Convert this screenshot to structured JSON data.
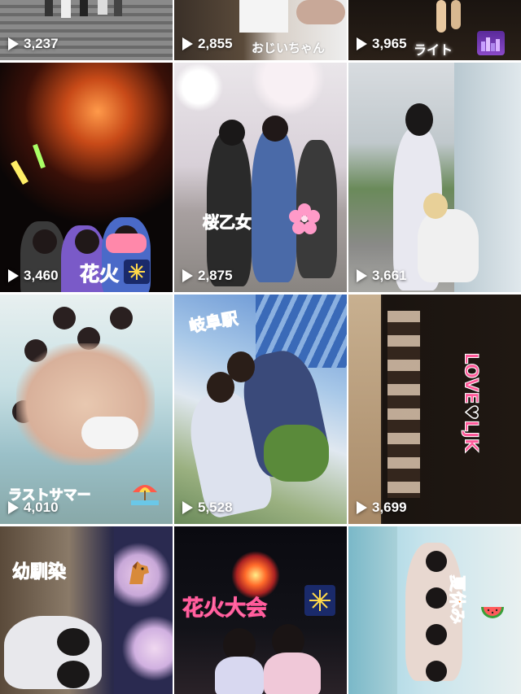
{
  "tiles": [
    {
      "views": "3,237",
      "caption": "",
      "emoji": ""
    },
    {
      "views": "2,855",
      "caption": "おじいちゃん",
      "emoji": ""
    },
    {
      "views": "3,965",
      "caption": "ライト",
      "emoji": "city-night"
    },
    {
      "views": "3,460",
      "caption": "花火",
      "emoji": "fireworks"
    },
    {
      "views": "2,875",
      "caption": "桜乙女",
      "emoji": "cherry-blossom"
    },
    {
      "views": "3,661",
      "caption": "",
      "emoji": ""
    },
    {
      "views": "4,010",
      "caption": "ラストサマー",
      "emoji": "beach-umbrella"
    },
    {
      "views": "5,528",
      "caption": "岐阜駅",
      "emoji": ""
    },
    {
      "views": "3,699",
      "caption": "LOVE♡LJK",
      "emoji": ""
    },
    {
      "views": "",
      "caption": "幼馴染",
      "emoji": "horse"
    },
    {
      "views": "",
      "caption": "花火大会",
      "emoji": "fireworks"
    },
    {
      "views": "",
      "caption": "夏休み",
      "emoji": "watermelon"
    }
  ],
  "colors": {
    "caption_pink": "#ff5a9a",
    "caption_blue": "#3aa0e0",
    "caption_orange": "#ff7a1a"
  }
}
